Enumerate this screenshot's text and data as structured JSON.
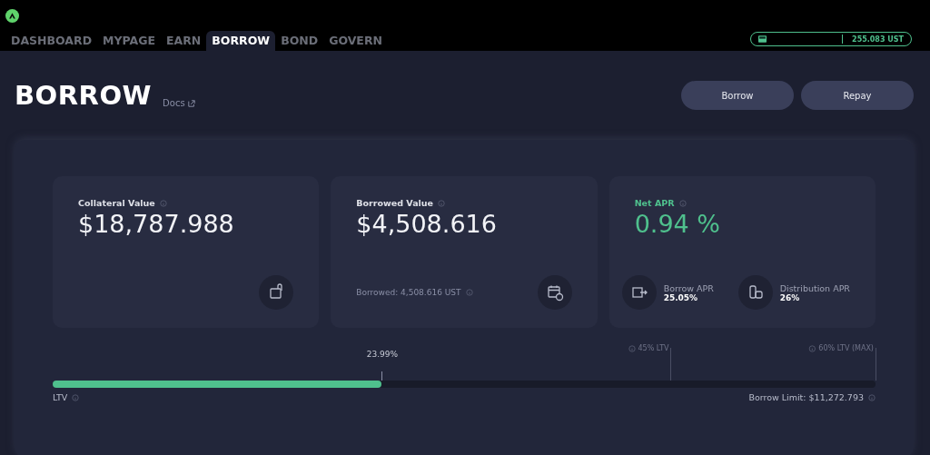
{
  "nav": {
    "tabs": [
      {
        "label": "DASHBOARD",
        "selected": false
      },
      {
        "label": "MYPAGE",
        "selected": false
      },
      {
        "label": "EARN",
        "selected": false
      },
      {
        "label": "BORROW",
        "selected": true
      },
      {
        "label": "BOND",
        "selected": false
      },
      {
        "label": "GOVERN",
        "selected": false
      }
    ],
    "wallet": {
      "balance": "255.083 UST"
    }
  },
  "header": {
    "title": "BORROW",
    "docs": "Docs",
    "buttons": [
      "Borrow",
      "Repay"
    ]
  },
  "cards": [
    {
      "kind": "collateral",
      "label": "Collateral Value",
      "value": "$18,787.988"
    },
    {
      "kind": "borrowed",
      "label": "Borrowed Value",
      "value": "$4,508.616",
      "note": "Borrowed: 4,508.616 UST"
    },
    {
      "kind": "apr",
      "label": "Net APR",
      "value": "0.94 %",
      "stats": [
        {
          "label": "Borrow APR",
          "value": "25.05%"
        },
        {
          "label": "Distribution APR",
          "value": "26%"
        }
      ]
    }
  ],
  "ltv": {
    "level": 0.4,
    "reading": "23.99%",
    "label": "LTV",
    "limit": "Borrow Limit: $11,272.793",
    "markers": [
      {
        "label": "45% LTV",
        "level": 0.75
      },
      {
        "label": "60% LTV (MAX)",
        "level": 1
      }
    ]
  }
}
